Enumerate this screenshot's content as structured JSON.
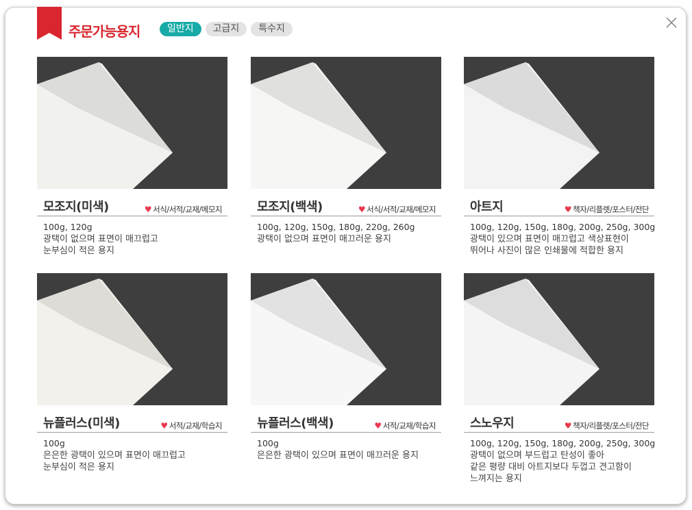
{
  "dialog": {
    "title": "주문가능용지",
    "tabs": [
      {
        "label": "일반지",
        "active": true
      },
      {
        "label": "고급지",
        "active": false
      },
      {
        "label": "특수지",
        "active": false
      }
    ],
    "close_icon": "close-icon",
    "accent_color": "#d9262f",
    "tab_active_color": "#17aaa6"
  },
  "papers": [
    {
      "name": "모조지(미색)",
      "usage": "서식/서적/교재/메모지",
      "weights": "100g, 120g",
      "description": "광택이 없으며 표면이 매끄럽고\n눈부심이 적은 용지"
    },
    {
      "name": "모조지(백색)",
      "usage": "서식/서적/교재/메모지",
      "weights": "100g, 120g, 150g, 180g, 220g, 260g",
      "description": "광택이 없으며 표면이 매끄러운 용지"
    },
    {
      "name": "아트지",
      "usage": "책자/리플렛/포스터/전단",
      "weights": "100g, 120g, 150g, 180g, 200g, 250g, 300g",
      "description": "광택이 있으며 표면이 매끄럽고 색상표현이\n뛰어나 사진이 많은 인쇄물에 적합한 용지"
    },
    {
      "name": "뉴플러스(미색)",
      "usage": "서적/교재/학습지",
      "weights": "100g",
      "description": "은은한 광택이 있으며 표면이 매끄럽고\n눈부심이 적은 용지"
    },
    {
      "name": "뉴플러스(백색)",
      "usage": "서적/교재/학습지",
      "weights": "100g",
      "description": "은은한 광택이 있으며 표면이 매끄러운 용지"
    },
    {
      "name": "스노우지",
      "usage": "책자/리플렛/포스터/전단",
      "weights": "100g, 120g, 150g, 180g, 200g, 250g, 300g",
      "description": "광택이 없으며 부드럽고 탄성이 좋아\n같은 평량 대비 아트지보다 두껍고 견고함이\n느껴지는 용지"
    }
  ]
}
